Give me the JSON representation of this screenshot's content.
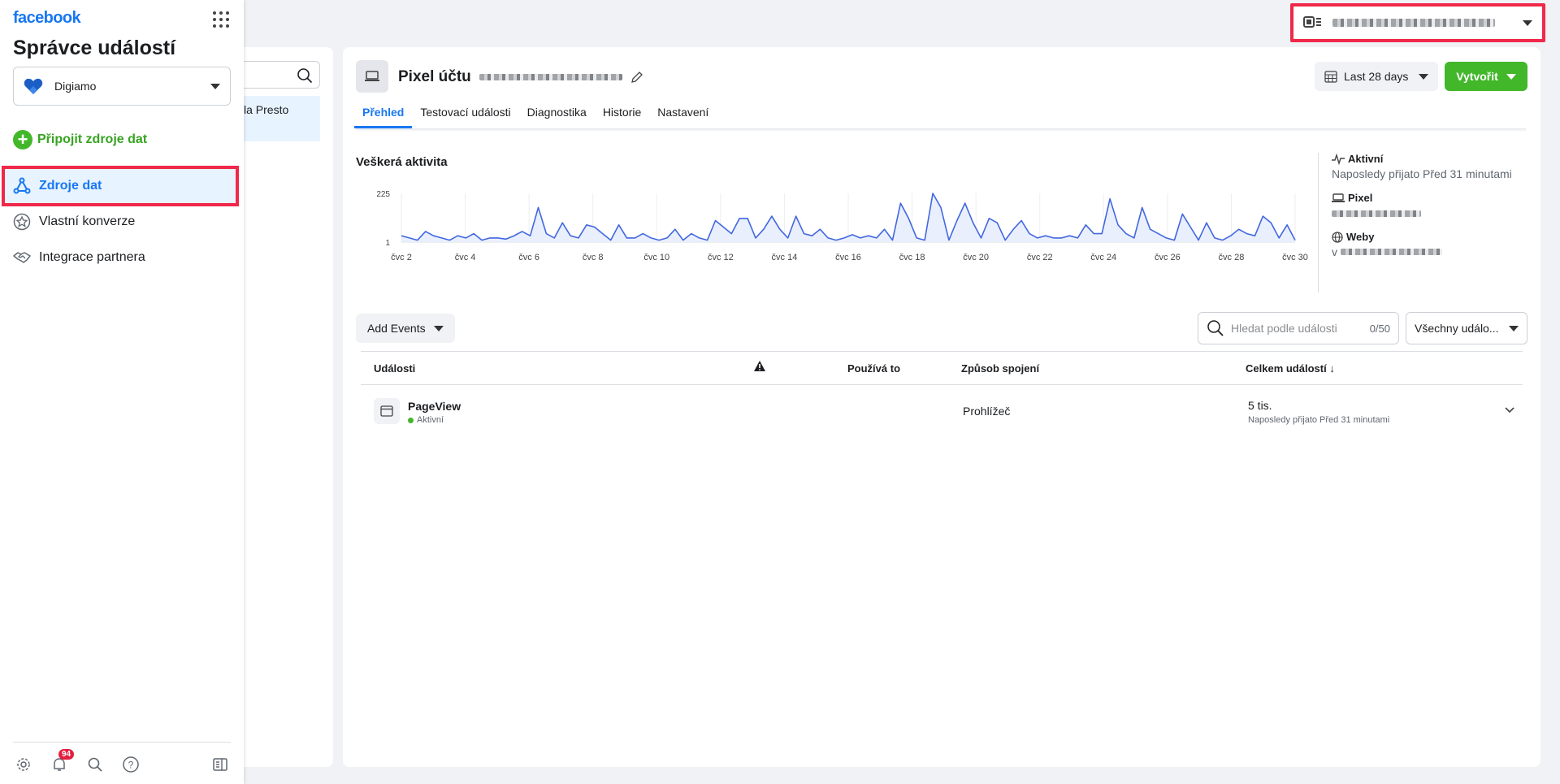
{
  "sidebar": {
    "logo": "facebook",
    "title": "Správce událostí",
    "account": "Digiamo",
    "connect_label": "Připojit zdroje dat",
    "items": [
      {
        "label": "Zdroje dat",
        "icon": "data-sources-icon",
        "active": true
      },
      {
        "label": "Vlastní konverze",
        "icon": "star-icon",
        "active": false
      },
      {
        "label": "Integrace partnera",
        "icon": "handshake-icon",
        "active": false
      }
    ],
    "notification_count": "94"
  },
  "list_panel": {
    "selected_item_text": "la Presto"
  },
  "pixel": {
    "title": "Pixel účtu",
    "date_range": "Last 28 days",
    "create_label": "Vytvořit",
    "tabs": [
      "Přehled",
      "Testovací události",
      "Diagnostika",
      "Historie",
      "Nastavení"
    ]
  },
  "activity": {
    "title": "Veškerá aktivita",
    "status_label": "Aktivní",
    "status_sub": "Naposledy přijato Před 31 minutami",
    "pixel_label": "Pixel",
    "sites_label": "Weby",
    "sites_prefix": "v"
  },
  "chart_data": {
    "type": "line",
    "title": "Veškerá aktivita",
    "xlabel": "",
    "ylabel": "",
    "ylim": [
      1,
      225
    ],
    "y_ticks": [
      "225",
      "1"
    ],
    "x_ticks": [
      "čvc 2",
      "čvc 4",
      "čvc 6",
      "čvc 8",
      "čvc 10",
      "čvc 12",
      "čvc 14",
      "čvc 16",
      "čvc 18",
      "čvc 20",
      "čvc 22",
      "čvc 24",
      "čvc 26",
      "čvc 28",
      "čvc 30"
    ],
    "x_range": [
      2,
      30
    ],
    "color": "#4267e0",
    "values": [
      30,
      20,
      10,
      50,
      30,
      20,
      10,
      30,
      20,
      40,
      10,
      20,
      20,
      15,
      30,
      50,
      30,
      160,
      40,
      20,
      90,
      30,
      20,
      80,
      70,
      40,
      10,
      80,
      20,
      20,
      40,
      20,
      10,
      20,
      60,
      10,
      40,
      20,
      10,
      100,
      70,
      40,
      110,
      110,
      20,
      60,
      120,
      60,
      20,
      120,
      40,
      30,
      60,
      20,
      10,
      20,
      35,
      20,
      30,
      20,
      60,
      10,
      180,
      110,
      20,
      10,
      230,
      160,
      10,
      100,
      180,
      90,
      20,
      110,
      90,
      10,
      60,
      100,
      40,
      20,
      30,
      20,
      20,
      30,
      20,
      80,
      40,
      40,
      200,
      80,
      40,
      20,
      160,
      60,
      40,
      20,
      10,
      130,
      70,
      10,
      90,
      20,
      10,
      30,
      60,
      40,
      30,
      120,
      90,
      20,
      80,
      10
    ]
  },
  "events": {
    "add_label": "Add Events",
    "search_placeholder": "Hledat podle události",
    "search_count": "0/50",
    "filter_label": "Všechny událo...",
    "columns": [
      "Události",
      "Používá to",
      "Způsob spojení",
      "Celkem událostí"
    ],
    "rows": [
      {
        "name": "PageView",
        "status": "Aktivní",
        "connection": "Prohlížeč",
        "total": "5 tis.",
        "total_sub": "Naposledy přijato Před 31 minutami"
      }
    ]
  }
}
